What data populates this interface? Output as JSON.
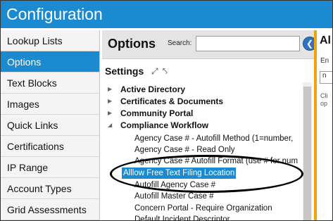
{
  "window": {
    "title": "Configuration"
  },
  "sidebar": {
    "items": [
      {
        "label": "Lookup Lists",
        "active": false
      },
      {
        "label": "Options",
        "active": true
      },
      {
        "label": "Text Blocks",
        "active": false
      },
      {
        "label": "Images",
        "active": false
      },
      {
        "label": "Quick Links",
        "active": false
      },
      {
        "label": "Certifications",
        "active": false
      },
      {
        "label": "IP Range",
        "active": false
      },
      {
        "label": "Account Types",
        "active": false
      },
      {
        "label": "Grid Assessments",
        "active": false
      }
    ]
  },
  "options": {
    "title": "Options",
    "search_label": "Search:",
    "search_value": "",
    "settings_title": "Settings",
    "tree": [
      {
        "label": "Active Directory",
        "expanded": false
      },
      {
        "label": "Certificates & Documents",
        "expanded": false
      },
      {
        "label": "Community Portal",
        "expanded": false
      },
      {
        "label": "Compliance Workflow",
        "expanded": true
      }
    ],
    "leaves": [
      "Agency Case # - Autofill Method (1=number,",
      "Agency Case # - Read Only",
      "Agency Case # Autofill Format (use # for num",
      "Alllow Free Text Filing Location",
      "Autofill Agency Case #",
      "Autofill Master Case #",
      "Concern Portal - Require Organization",
      "Default Incident Descriptor"
    ],
    "selected_leaf": "Alllow Free Text Filing Location"
  },
  "right_panel": {
    "title": "Al",
    "label": "En",
    "field": "n",
    "hint": "Cli op"
  },
  "colors": {
    "accent": "#1b8ad0",
    "highlight_border": "#f2a500"
  }
}
